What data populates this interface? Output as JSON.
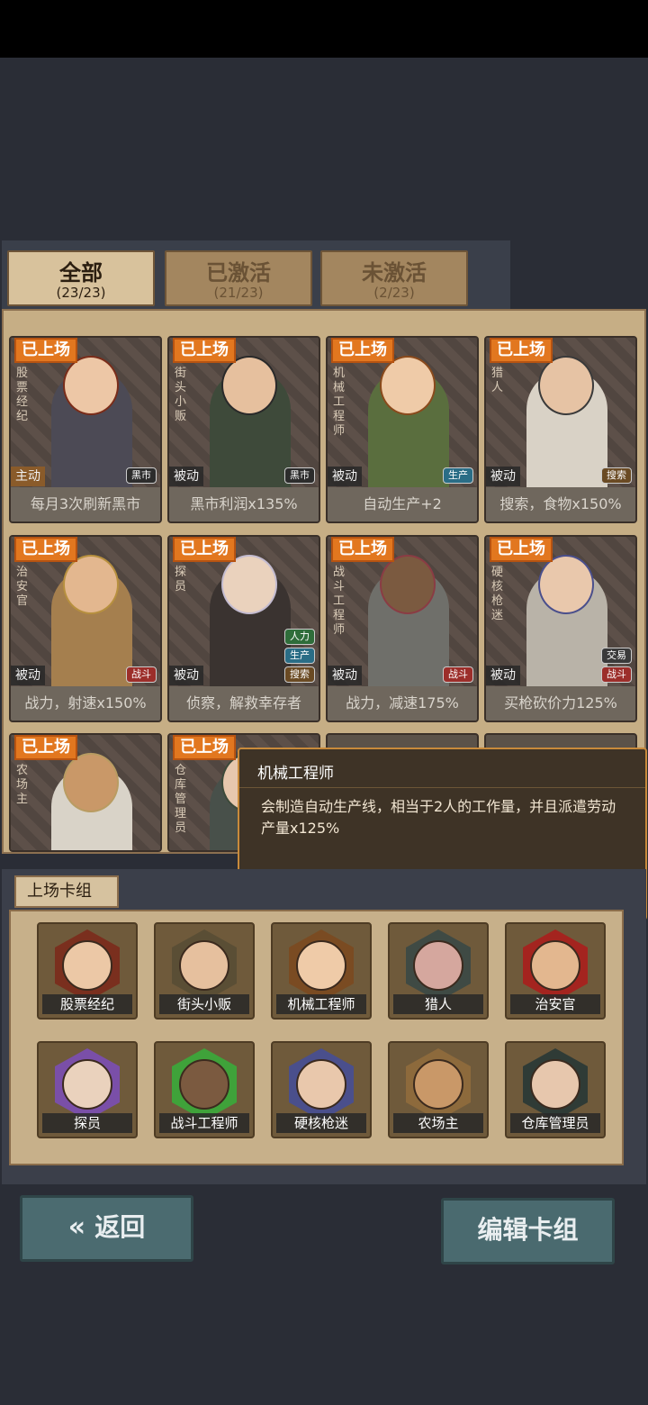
{
  "tabs": [
    {
      "label": "全部",
      "count": "(23/23)"
    },
    {
      "label": "已激活",
      "count": "(21/23)"
    },
    {
      "label": "未激活",
      "count": "(2/23)"
    }
  ],
  "cards": [
    {
      "status": "已上场",
      "name": "股票经纪",
      "mode": "主动",
      "tags": [
        "黑市"
      ],
      "desc": "每月3次刷新黑市"
    },
    {
      "status": "已上场",
      "name": "街头小贩",
      "mode": "被动",
      "tags": [
        "黑市"
      ],
      "desc": "黑市利润x135%"
    },
    {
      "status": "已上场",
      "name": "机械工程师",
      "mode": "被动",
      "tags": [
        "生产"
      ],
      "desc": "自动生产+2"
    },
    {
      "status": "已上场",
      "name": "猎人",
      "mode": "被动",
      "tags": [
        "搜索"
      ],
      "desc": "搜索，食物x150%"
    },
    {
      "status": "已上场",
      "name": "治安官",
      "mode": "被动",
      "tags": [
        "战斗"
      ],
      "desc": "战力，射速x150%"
    },
    {
      "status": "已上场",
      "name": "探员",
      "mode": "被动",
      "tags": [
        "人力",
        "生产",
        "搜索"
      ],
      "desc": "侦察，解救幸存者"
    },
    {
      "status": "已上场",
      "name": "战斗工程师",
      "mode": "被动",
      "tags": [
        "战斗"
      ],
      "desc": "战力，减速175%"
    },
    {
      "status": "已上场",
      "name": "硬核枪迷",
      "mode": "被动",
      "tags": [
        "交易",
        "战斗"
      ],
      "desc": "买枪砍价力125%"
    },
    {
      "status": "已上场",
      "name": "农场主"
    },
    {
      "status": "已上场",
      "name": "仓库管理员"
    }
  ],
  "tooltip": {
    "title": "机械工程师",
    "body": "会制造自动生产线，相当于2人的工作量，并且派遣劳动产量x125%"
  },
  "deck": {
    "title": "上场卡组",
    "slots": [
      "股票经纪",
      "街头小贩",
      "机械工程师",
      "猎人",
      "治安官",
      "探员",
      "战斗工程师",
      "硬核枪迷",
      "农场主",
      "仓库管理员"
    ]
  },
  "buttons": {
    "back": "返回",
    "edit": "编辑卡组"
  }
}
